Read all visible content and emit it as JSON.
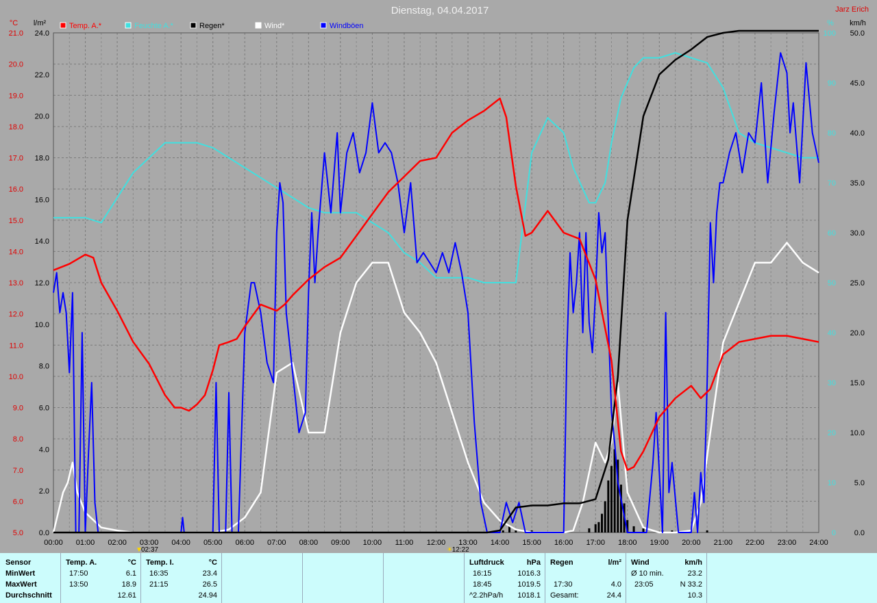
{
  "chart_data": {
    "type": "line",
    "title": "Dienstag, 04.04.2017",
    "author": "Jarz Erich",
    "x_ticks": [
      "00:00",
      "01:00",
      "02:00",
      "03:00",
      "04:00",
      "05:00",
      "06:00",
      "07:00",
      "08:00",
      "09:00",
      "10:00",
      "11:00",
      "12:00",
      "13:00",
      "14:00",
      "15:00",
      "16:00",
      "17:00",
      "18:00",
      "19:00",
      "20:00",
      "21:00",
      "22:00",
      "23:00",
      "24:00"
    ],
    "xlim": [
      0,
      24
    ],
    "axes": {
      "temp": {
        "unit": "°C",
        "ticks": [
          "21.0",
          "20.0",
          "19.0",
          "18.0",
          "17.0",
          "16.0",
          "15.0",
          "14.0",
          "13.0",
          "12.0",
          "11.0",
          "10.0",
          "9.0",
          "8.0",
          "7.0",
          "6.0",
          "5.0"
        ],
        "ylim": [
          5,
          21
        ],
        "color": "#e8001c"
      },
      "rain": {
        "unit": "l/m²",
        "ticks": [
          "24.0",
          "22.0",
          "20.0",
          "18.0",
          "16.0",
          "14.0",
          "12.0",
          "10.0",
          "8.0",
          "6.0",
          "4.0",
          "2.0",
          "0.0"
        ],
        "ylim": [
          0,
          24
        ],
        "color": "#000000"
      },
      "humidity": {
        "unit": "%",
        "ticks": [
          "100",
          "90",
          "80",
          "70",
          "60",
          "50",
          "40",
          "30",
          "20",
          "10",
          "0"
        ],
        "ylim": [
          0,
          100
        ],
        "color": "#40e0e0"
      },
      "wind": {
        "unit": "km/h",
        "ticks": [
          "50.0",
          "45.0",
          "40.0",
          "35.0",
          "30.0",
          "25.0",
          "20.0",
          "15.0",
          "10.0",
          "5.0",
          "0.0"
        ],
        "ylim": [
          0,
          50
        ],
        "color": "#000000"
      }
    },
    "legend": [
      {
        "name": "Temp. A.*",
        "color": "#ff0000"
      },
      {
        "name": "Feuchte A.*",
        "color": "#40e0e0"
      },
      {
        "name": "Regen*",
        "color": "#000000"
      },
      {
        "name": "Wind*",
        "color": "#ffffff"
      },
      {
        "name": "Windböen",
        "color": "#0000ff"
      }
    ],
    "markers": [
      {
        "time": "02:37",
        "x": 2.62,
        "symbol": "▼"
      },
      {
        "time": "12:22",
        "x": 12.37,
        "symbol": "☀"
      }
    ],
    "series": [
      {
        "name": "Temp. A.*",
        "axis": "temp",
        "color": "#ff0000",
        "x": [
          0,
          0.5,
          1,
          1.25,
          1.5,
          2,
          2.5,
          3,
          3.5,
          3.8,
          4,
          4.25,
          4.5,
          4.75,
          5,
          5.2,
          5.5,
          5.75,
          6,
          6.5,
          7,
          7.25,
          7.5,
          8,
          8.5,
          9,
          9.5,
          10,
          10.5,
          11,
          11.5,
          12,
          12.5,
          13,
          13.5,
          14,
          14.2,
          14.5,
          14.8,
          15,
          15.5,
          16,
          16.5,
          17,
          17.5,
          17.8,
          18,
          18.2,
          18.5,
          19,
          19.5,
          20,
          20.3,
          20.6,
          21,
          21.5,
          22,
          22.5,
          23,
          23.5,
          24
        ],
        "y": [
          13.4,
          13.6,
          13.9,
          13.8,
          13.0,
          12.1,
          11.1,
          10.4,
          9.4,
          9.0,
          9.0,
          8.9,
          9.1,
          9.4,
          10.2,
          11.0,
          11.1,
          11.2,
          11.6,
          12.3,
          12.1,
          12.3,
          12.6,
          13.1,
          13.5,
          13.8,
          14.5,
          15.2,
          15.9,
          16.4,
          16.9,
          17.0,
          17.8,
          18.2,
          18.5,
          18.9,
          18.3,
          16.1,
          14.5,
          14.6,
          15.3,
          14.6,
          14.4,
          13.1,
          10.5,
          7.6,
          7.0,
          7.1,
          7.6,
          8.7,
          9.3,
          9.7,
          9.3,
          9.6,
          10.7,
          11.1,
          11.2,
          11.3,
          11.3,
          11.2,
          11.1
        ]
      },
      {
        "name": "Feuchte A.*",
        "axis": "humidity",
        "color": "#40e0e0",
        "x": [
          0,
          0.5,
          1,
          1.5,
          2,
          2.5,
          3,
          3.5,
          4,
          4.5,
          5,
          5.5,
          6,
          6.5,
          7,
          7.5,
          8,
          8.5,
          9,
          9.5,
          10,
          10.5,
          11,
          11.5,
          12,
          12.5,
          13,
          13.5,
          14,
          14.5,
          15,
          15.5,
          16,
          16.3,
          16.8,
          17,
          17.3,
          17.5,
          17.8,
          18.2,
          18.5,
          19,
          19.5,
          20,
          20.5,
          21,
          21.5,
          22,
          22.5,
          23,
          23.5,
          24
        ],
        "y": [
          63,
          63,
          63,
          62,
          67,
          72,
          75,
          78,
          78,
          78,
          77,
          75,
          73,
          71,
          69,
          67,
          65,
          64,
          64,
          64,
          62,
          60,
          56,
          54,
          51,
          51,
          51,
          50,
          50,
          50,
          76,
          83,
          80,
          73,
          66,
          66,
          70,
          78,
          87,
          93,
          95,
          95,
          96,
          95,
          94,
          89,
          80,
          78,
          77,
          76,
          75,
          75
        ]
      },
      {
        "name": "Regen*",
        "axis": "rain",
        "color": "#000000",
        "x": [
          0,
          13.6,
          14.0,
          14.5,
          15.0,
          15.5,
          16.0,
          16.5,
          17.0,
          17.4,
          17.7,
          18.0,
          18.5,
          19.0,
          19.5,
          20.0,
          20.5,
          21.0,
          21.5,
          22.0,
          23.0,
          24.0
        ],
        "y": [
          0,
          0,
          0.1,
          1.2,
          1.3,
          1.3,
          1.4,
          1.4,
          1.6,
          3.5,
          7.5,
          15,
          20,
          22.0,
          22.7,
          23.2,
          23.8,
          24.0,
          24.1,
          24.1,
          24.1,
          24.1
        ]
      },
      {
        "name": "Wind*",
        "axis": "wind",
        "color": "#ffffff",
        "x": [
          0,
          0.3,
          0.45,
          0.6,
          0.75,
          1,
          1.5,
          2,
          2.5,
          3,
          3.5,
          4,
          4.5,
          5,
          5.5,
          6,
          6.5,
          7,
          7.5,
          8,
          8.5,
          9,
          9.5,
          10,
          10.5,
          11,
          11.5,
          12,
          12.5,
          13,
          13.5,
          14,
          14.5,
          15,
          15.5,
          16,
          16.3,
          16.6,
          17,
          17.3,
          17.5,
          17.7,
          18,
          18.5,
          19,
          19.5,
          20,
          20.3,
          20.6,
          21,
          21.5,
          22,
          22.5,
          23,
          23.5,
          24
        ],
        "y": [
          0,
          4,
          5,
          7,
          4,
          2,
          0.5,
          0.2,
          0,
          0,
          0,
          0,
          0,
          0,
          0.3,
          1.5,
          4,
          16,
          17,
          10,
          10,
          20,
          25,
          27,
          27,
          22,
          20,
          17,
          12,
          7,
          3,
          1.2,
          0.3,
          0,
          0,
          0,
          0.2,
          3,
          9,
          7,
          9,
          15,
          4,
          0.5,
          0,
          0,
          0.2,
          3,
          10,
          19,
          23,
          27,
          27,
          29,
          27,
          26
        ]
      },
      {
        "name": "Windböen",
        "axis": "wind",
        "color": "#0000ff",
        "x": [
          0,
          0.1,
          0.2,
          0.3,
          0.4,
          0.5,
          0.6,
          0.7,
          0.8,
          0.9,
          1.0,
          1.1,
          1.2,
          1.3,
          1.4,
          1.5,
          1.6,
          1.8,
          2.0,
          4.0,
          4.05,
          4.1,
          5.0,
          5.1,
          5.2,
          5.4,
          5.5,
          5.6,
          5.8,
          6.0,
          6.2,
          6.3,
          6.5,
          6.7,
          6.9,
          7.0,
          7.1,
          7.2,
          7.3,
          7.5,
          7.7,
          7.9,
          8.0,
          8.1,
          8.2,
          8.3,
          8.5,
          8.7,
          8.9,
          9.0,
          9.2,
          9.4,
          9.6,
          9.8,
          10.0,
          10.2,
          10.4,
          10.6,
          10.8,
          11.0,
          11.2,
          11.4,
          11.6,
          11.8,
          12.0,
          12.2,
          12.4,
          12.6,
          12.8,
          13.0,
          13.2,
          13.4,
          13.6,
          13.8,
          14.0,
          14.2,
          14.4,
          14.6,
          14.8,
          15.0,
          16.0,
          16.1,
          16.2,
          16.3,
          16.4,
          16.5,
          16.6,
          16.7,
          16.8,
          16.9,
          17.0,
          17.1,
          17.2,
          17.3,
          17.4,
          17.5,
          17.6,
          17.7,
          18.0,
          18.5,
          18.6,
          18.8,
          18.9,
          19.0,
          19.1,
          19.2,
          19.3,
          19.4,
          19.6,
          19.8,
          20.0,
          20.1,
          20.2,
          20.3,
          20.4,
          20.5,
          20.6,
          20.7,
          20.8,
          20.9,
          21.0,
          21.2,
          21.4,
          21.6,
          21.8,
          22.0,
          22.2,
          22.4,
          22.6,
          22.8,
          23.0,
          23.1,
          23.2,
          23.4,
          23.6,
          23.8,
          24.0
        ],
        "y": [
          24,
          26,
          22,
          24,
          22,
          16,
          24,
          0,
          0,
          20,
          0,
          8,
          15,
          3,
          0,
          0,
          0,
          0,
          0,
          0,
          1.5,
          0,
          0,
          15,
          0,
          0,
          14,
          0,
          0,
          20,
          25,
          25,
          22,
          17,
          15,
          30,
          35,
          33,
          22,
          16,
          10,
          12,
          24,
          32,
          25,
          30,
          38,
          32,
          40,
          32,
          38,
          40,
          36,
          38,
          43,
          38,
          39,
          38,
          35,
          30,
          35,
          27,
          28,
          27,
          26,
          28,
          26,
          29,
          26,
          22,
          11,
          3,
          0,
          0,
          0,
          3,
          1,
          3,
          0,
          0,
          0,
          18,
          28,
          22,
          25,
          30,
          20,
          30,
          21,
          18,
          24,
          32,
          28,
          30,
          21,
          12,
          9,
          5,
          0,
          0,
          0,
          7,
          12,
          6,
          0,
          22,
          4,
          7,
          0,
          0,
          0,
          4,
          0,
          6,
          3,
          15,
          31,
          25,
          32,
          35,
          35,
          38,
          40,
          36,
          40,
          39,
          45,
          35,
          42,
          48,
          46,
          40,
          43,
          35,
          47,
          40,
          37
        ]
      }
    ],
    "rain_bars": {
      "x": [
        14.1,
        14.3,
        14.5,
        15.0,
        16.8,
        17.0,
        17.1,
        17.2,
        17.3,
        17.4,
        17.5,
        17.6,
        17.7,
        17.8,
        17.9,
        18.0,
        18.2,
        18.5,
        19.1,
        19.4,
        20.5
      ],
      "y": [
        0.1,
        0.3,
        0.1,
        0.1,
        0.2,
        0.4,
        0.5,
        0.9,
        1.5,
        2.5,
        3.2,
        4.0,
        3.5,
        2.3,
        1.4,
        0.6,
        0.3,
        0.2,
        0.1,
        0.1,
        0.1
      ]
    }
  },
  "stats": {
    "headers": {
      "sensor": "Sensor",
      "temp_a": "Temp. A.",
      "temp_a_unit": "°C",
      "temp_i": "Temp. I.",
      "temp_i_unit": "°C",
      "pressure": "Luftdruck",
      "pressure_unit": "hPa",
      "rain": "Regen",
      "rain_unit": "l/m²",
      "wind": "Wind",
      "wind_unit": "km/h"
    },
    "rows": [
      {
        "label": "MinWert",
        "ta_time": "17:50",
        "ta_val": "6.1",
        "ti_time": "16:35",
        "ti_val": "23.4",
        "p_time": "16:15",
        "p_val": "1016.3",
        "r_time": "",
        "r_val": "",
        "w_time": "Ø 10 min.",
        "w_val": "23.2"
      },
      {
        "label": "MaxWert",
        "ta_time": "13:50",
        "ta_val": "18.9",
        "ti_time": "21:15",
        "ti_val": "26.5",
        "p_time": "18:45",
        "p_val": "1019.5",
        "r_time": "17:30",
        "r_val": "4.0",
        "w_time": "23:05",
        "w_val": "N 33.2"
      },
      {
        "label": "Durchschnitt",
        "ta_time": "",
        "ta_val": "12.61",
        "ti_time": "",
        "ti_val": "24.94",
        "p_time": "^2.2hPa/h",
        "p_val": "1018.1",
        "r_time": "Gesamt:",
        "r_val": "24.4",
        "w_time": "",
        "w_val": "10.3"
      }
    ]
  }
}
